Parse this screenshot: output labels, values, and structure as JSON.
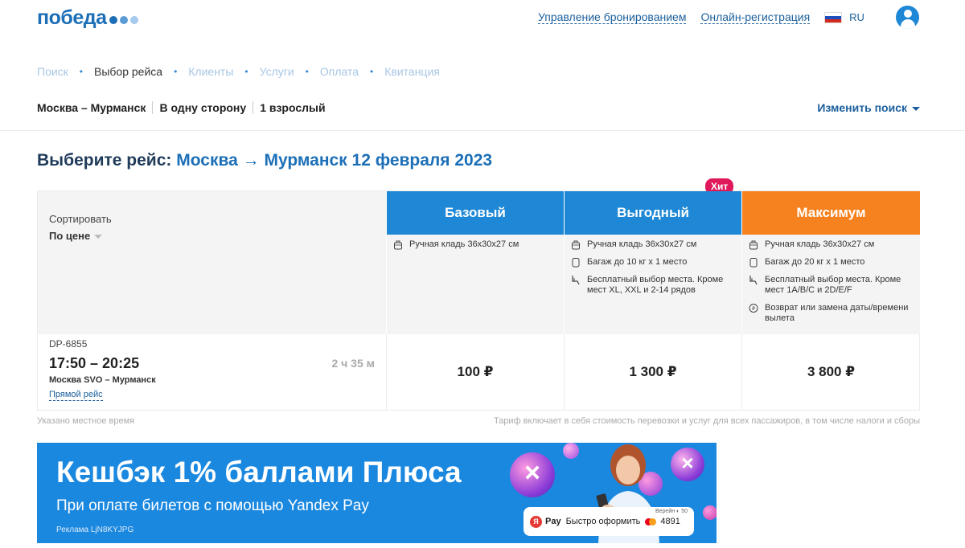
{
  "header": {
    "logo_text": "победа",
    "links": [
      "Управление бронированием",
      "Онлайн-регистрация"
    ],
    "lang": "RU"
  },
  "steps": [
    {
      "label": "Поиск",
      "active": false
    },
    {
      "label": "Выбор рейса",
      "active": true
    },
    {
      "label": "Клиенты",
      "active": false
    },
    {
      "label": "Услуги",
      "active": false
    },
    {
      "label": "Оплата",
      "active": false
    },
    {
      "label": "Квитанция",
      "active": false
    }
  ],
  "summary": {
    "route": "Москва – Мурманск",
    "trip": "В одну сторону",
    "pax": "1 взрослый",
    "change_label": "Изменить поиск"
  },
  "heading": {
    "prefix": "Выберите рейс:",
    "from": "Москва",
    "arrow": "→",
    "to": "Мурманск 12 февраля 2023"
  },
  "table": {
    "sort_label": "Сортировать",
    "sort_value": "По цене",
    "hit_badge": "Хит",
    "tariffs": [
      {
        "name": "Базовый",
        "color": "#1e88d6",
        "features": [
          {
            "icon": "hand-luggage-icon",
            "text": "Ручная кладь 36x30x27 см"
          }
        ]
      },
      {
        "name": "Выгодный",
        "color": "#1e88d6",
        "features": [
          {
            "icon": "hand-luggage-icon",
            "text": "Ручная кладь 36x30x27 см"
          },
          {
            "icon": "baggage-icon",
            "text": "Багаж до 10 кг x 1 место"
          },
          {
            "icon": "seat-icon",
            "text": "Бесплатный выбор места. Кроме мест XL, XXL и 2-14 рядов"
          }
        ]
      },
      {
        "name": "Максимум",
        "color": "#f5821f",
        "features": [
          {
            "icon": "hand-luggage-icon",
            "text": "Ручная кладь 36x30x27 см"
          },
          {
            "icon": "baggage-icon",
            "text": "Багаж до 20 кг x 1 место"
          },
          {
            "icon": "seat-icon",
            "text": "Бесплатный выбор места. Кроме мест 1A/B/C и 2D/E/F"
          },
          {
            "icon": "refund-icon",
            "text": "Возврат или замена даты/времени вылета"
          }
        ]
      }
    ],
    "flight": {
      "code": "DP-6855",
      "time": "17:50 – 20:25",
      "route": "Москва SVO – Мурманск",
      "direct": "Прямой рейс",
      "duration": "2 ч 35 м",
      "prices": [
        "100 ₽",
        "1 300 ₽",
        "3 800 ₽"
      ]
    }
  },
  "notes": {
    "left": "Указано местное время",
    "right": "Тариф включает в себя стоимость перевозки и услуг для всех пассажиров, в том числе налоги и сборы"
  },
  "banner": {
    "title": "Кешбэк 1% баллами Плюса",
    "subtitle": "При оплате билетов с помощью Yandex Pay",
    "ad": "Реклама LjN8KYJPG",
    "pay_label": "Pay",
    "pay_action": "Быстро оформить",
    "card_num": "4891",
    "pay_meta": "Верейн ◐ 50"
  }
}
